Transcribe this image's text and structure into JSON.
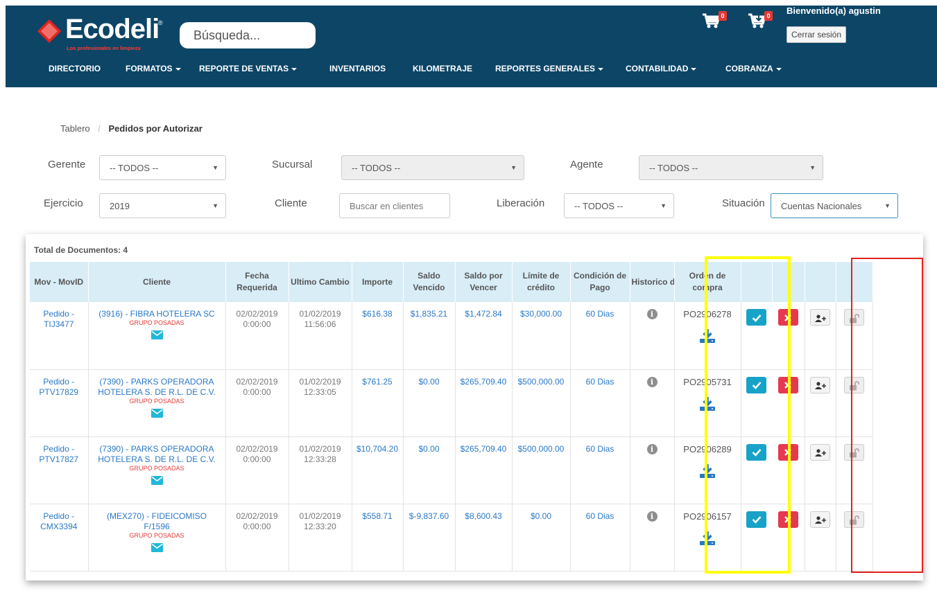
{
  "header": {
    "brand": "Ecodeli",
    "registered": "®",
    "tagline": "Los profesionales en limpieza",
    "search_placeholder": "Búsqueda...",
    "cart_badge": "0",
    "cart2_badge": "0",
    "welcome": "Bienvenido(a) agustin",
    "logout_label": "Cerrar sesión",
    "colors": {
      "bar": "#0c4566",
      "badge": "#e53935"
    }
  },
  "nav": [
    {
      "label": "DIRECTORIO",
      "dropdown": false
    },
    {
      "label": "FORMATOS",
      "dropdown": true
    },
    {
      "label": "REPORTE DE VENTAS",
      "dropdown": true
    },
    {
      "label": "INVENTARIOS",
      "dropdown": false
    },
    {
      "label": "KILOMETRAJE",
      "dropdown": false
    },
    {
      "label": "REPORTES GENERALES",
      "dropdown": true
    },
    {
      "label": "CONTABILIDAD",
      "dropdown": true
    },
    {
      "label": "COBRANZA",
      "dropdown": true
    }
  ],
  "breadcrumb": {
    "home": "Tablero",
    "separator": "/",
    "current": "Pedidos por Autorizar"
  },
  "filters": {
    "gerente": {
      "label": "Gerente",
      "value": "-- TODOS --"
    },
    "sucursal": {
      "label": "Sucursal",
      "value": "-- TODOS --"
    },
    "agente": {
      "label": "Agente",
      "value": "-- TODOS --"
    },
    "ejercicio": {
      "label": "Ejercicio",
      "value": "2019"
    },
    "cliente": {
      "label": "Cliente",
      "placeholder": "Buscar en clientes"
    },
    "liberacion": {
      "label": "Liberación",
      "value": "-- TODOS --"
    },
    "situacion": {
      "label": "Situación",
      "value": "Cuentas Nacionales"
    }
  },
  "table": {
    "total_label": "Total de Documentos: 4",
    "headers": {
      "mov": "Mov - MovID",
      "cliente": "Cliente",
      "fecha": "Fecha Requerida",
      "ultimo": "Ultimo Cambio",
      "importe": "Importe",
      "saldo_vencido": "Saldo Vencido",
      "saldo_por_vencer": "Saldo por Vencer",
      "limite": "Límite de crédito",
      "condicion": "Condición de Pago",
      "historico": "Historico de Venta",
      "orden": "Orden de compra"
    },
    "rows": [
      {
        "mov": "Pedido - TIJ3477",
        "cliente": "(3916) - FIBRA HOTELERA SC",
        "grupo": "GRUPO POSADAS",
        "fecha_date": "02/02/2019",
        "fecha_time": "0:00:00",
        "ultimo_date": "01/02/2019",
        "ultimo_time": "11:56:06",
        "importe": "$616.38",
        "saldo_vencido": "$1,835.21",
        "saldo_por_vencer": "$1,472.84",
        "limite": "$30,000.00",
        "condicion": "60 Dias",
        "orden": "PO2906278"
      },
      {
        "mov": "Pedido - PTV17829",
        "cliente": "(7390) - PARKS OPERADORA HOTELERA S. DE R.L. DE C.V.",
        "grupo": "GRUPO POSADAS",
        "fecha_date": "02/02/2019",
        "fecha_time": "0:00:00",
        "ultimo_date": "01/02/2019",
        "ultimo_time": "12:33:05",
        "importe": "$761.25",
        "saldo_vencido": "$0.00",
        "saldo_por_vencer": "$265,709.40",
        "limite": "$500,000.00",
        "condicion": "60 Dias",
        "orden": "PO2905731"
      },
      {
        "mov": "Pedido - PTV17827",
        "cliente": "(7390) - PARKS OPERADORA HOTELERA S. DE R.L. DE C.V.",
        "grupo": "GRUPO POSADAS",
        "fecha_date": "02/02/2019",
        "fecha_time": "0:00:00",
        "ultimo_date": "01/02/2019",
        "ultimo_time": "12:33:28",
        "importe": "$10,704.20",
        "saldo_vencido": "$0.00",
        "saldo_por_vencer": "$265,709.40",
        "limite": "$500,000.00",
        "condicion": "60 Dias",
        "orden": "PO2906289"
      },
      {
        "mov": "Pedido - CMX3394",
        "cliente": "(MEX270) - FIDEICOMISO F/1596",
        "grupo": "GRUPO POSADAS",
        "fecha_date": "02/02/2019",
        "fecha_time": "0:00:00",
        "ultimo_date": "01/02/2019",
        "ultimo_time": "12:33:20",
        "importe": "$558.71",
        "saldo_vencido": "$-9,837.60",
        "saldo_por_vencer": "$8,600.43",
        "limite": "$0.00",
        "condicion": "60 Dias",
        "orden": "PO2906157"
      }
    ]
  },
  "icons": {
    "cart": "shopping-cart-icon",
    "cart_download": "cart-download-icon",
    "mail": "envelope-icon",
    "info": "info-circle-icon",
    "download": "download-icon",
    "approve": "check-icon",
    "reject": "close-icon",
    "assign": "user-plus-icon",
    "unlock": "unlock-icon"
  },
  "highlights": {
    "yellow": "#ffff00",
    "red": "#e0201c"
  }
}
